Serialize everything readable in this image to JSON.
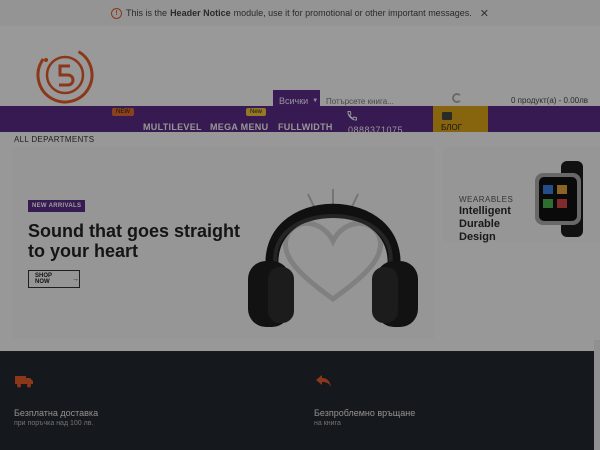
{
  "notice": {
    "prefix": "This is the",
    "bold": "Header Notice",
    "suffix": "module, use it for promotional or other important messages."
  },
  "search": {
    "category": "Всички",
    "placeholder": "Потърсете книга..."
  },
  "cart": {
    "text": "0 продукт(а) - 0.00лв"
  },
  "nav": {
    "items": [
      {
        "label": "MULTILEVEL",
        "badge": "NEW",
        "badge_color": "#e06a2c"
      },
      {
        "label": "MEGA MENU",
        "badge": "New",
        "badge_color": "#f0c23c"
      },
      {
        "label": "FULLWIDTH",
        "badge": "",
        "badge_color": ""
      }
    ],
    "phone": "0888371075",
    "blog": "БЛОГ"
  },
  "departments": "ALL DEPARTMENTS",
  "hero": {
    "tag": "NEW ARRIVALS",
    "title": "Sound that goes straight to your heart",
    "button": "SHOP NOW"
  },
  "side_card": {
    "category": "WEARABLES",
    "title": "Intelligent Durable Design"
  },
  "features": [
    {
      "icon": "truck-icon",
      "title": "Безплатна доставка",
      "subtitle": "при поръчка над 100 лв."
    },
    {
      "icon": "return-arrow-icon",
      "title": "Безпроблемно връщане",
      "subtitle": "на книга"
    }
  ],
  "colors": {
    "brand_purple": "#5a2a85",
    "accent_orange": "#e05a2a",
    "blog_yellow": "#d9a417",
    "footer_dark": "#22272e"
  }
}
